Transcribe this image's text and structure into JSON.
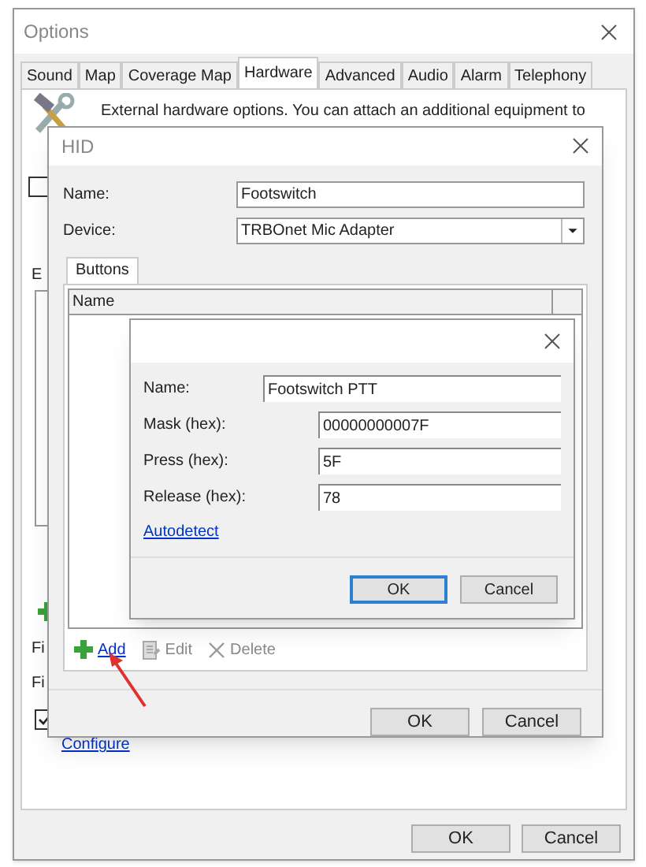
{
  "options_window": {
    "title": "Options",
    "tabs": [
      {
        "label": "Sound",
        "selected": false
      },
      {
        "label": "Map",
        "selected": false
      },
      {
        "label": "Coverage Map",
        "selected": false
      },
      {
        "label": "Hardware",
        "selected": true
      },
      {
        "label": "Advanced",
        "selected": false
      },
      {
        "label": "Audio",
        "selected": false
      },
      {
        "label": "Alarm",
        "selected": false
      },
      {
        "label": "Telephony",
        "selected": false
      }
    ],
    "description": "External hardware options. You can attach an additional equipment to",
    "first_checkbox": {
      "checked": false
    },
    "section_label": "E",
    "field_labels": [
      "Fi",
      "Fi"
    ],
    "last_checkbox": {
      "checked": true
    },
    "link": "Configure",
    "buttons": [
      "OK",
      "Cancel"
    ]
  },
  "hid_dialog": {
    "title": "HID",
    "fields": [
      {
        "kind": "text",
        "label": "Name:",
        "value": "Footswitch"
      },
      {
        "kind": "dropdown",
        "label": "Device:",
        "value": "TRBOnet Mic Adapter"
      }
    ],
    "tabs": [
      {
        "label": "Buttons",
        "selected": true
      }
    ],
    "table": {
      "columns": [
        "Name"
      ]
    },
    "toolbar": [
      {
        "kind": "add",
        "label": "Add",
        "disabled": false
      },
      {
        "kind": "edit",
        "label": "Edit",
        "disabled": true
      },
      {
        "kind": "delete",
        "label": "Delete",
        "disabled": true
      }
    ],
    "buttons": [
      "OK",
      "Cancel"
    ]
  },
  "button_dialog": {
    "fields": [
      {
        "label": "Name:",
        "value": "Footswitch PTT"
      },
      {
        "label": "Mask (hex):",
        "value": "00000000007F"
      },
      {
        "label": "Press (hex):",
        "value": "5F"
      },
      {
        "label": "Release (hex):",
        "value": "78"
      }
    ],
    "link": "Autodetect",
    "buttons": [
      {
        "label": "OK",
        "focused": true
      },
      {
        "label": "Cancel",
        "focused": false
      }
    ]
  }
}
